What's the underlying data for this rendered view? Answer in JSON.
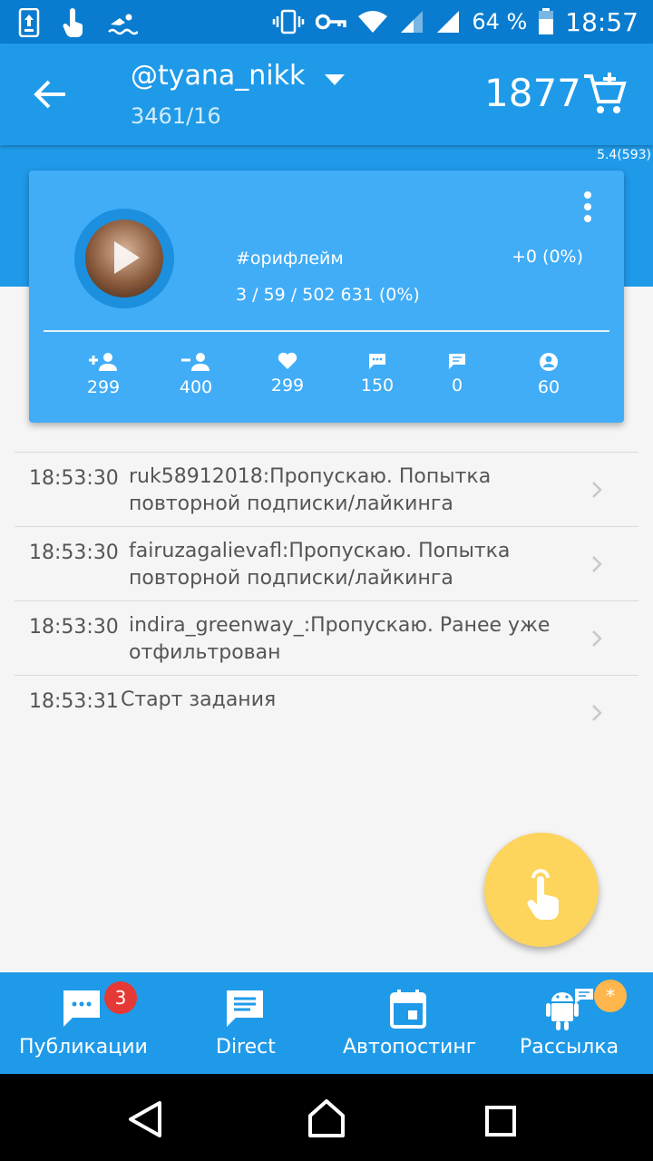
{
  "status_bar": {
    "battery_percent": "64 %",
    "time": "18:57"
  },
  "app_bar": {
    "account": "@tyana_nikk",
    "account_stats": "3461/16",
    "balance": "1877"
  },
  "version": "5.4(593)",
  "card": {
    "hashtag": "#орифлейм",
    "delta": "+0 (0%)",
    "counts": "3 / 59 / 502 631 (0%)",
    "stats": [
      {
        "icon": "follow-icon",
        "value": "299"
      },
      {
        "icon": "unfollow-icon",
        "value": "400"
      },
      {
        "icon": "heart-icon",
        "value": "299"
      },
      {
        "icon": "comment-icon",
        "value": "150"
      },
      {
        "icon": "message-icon",
        "value": "0"
      },
      {
        "icon": "profile-icon",
        "value": "60"
      }
    ]
  },
  "log": [
    {
      "time": "18:53:30",
      "message": "ruk58912018:Пропускаю. Попытка повторной подписки/лайкинга"
    },
    {
      "time": "18:53:30",
      "message": "fairuzagalievafl:Пропускаю. Попытка повторной подписки/лайкинга"
    },
    {
      "time": "18:53:30",
      "message": "indira_greenway_:Пропускаю. Ранее уже отфильтрован"
    },
    {
      "time": "18:53:31",
      "message": "Старт задания"
    }
  ],
  "bottom_nav": [
    {
      "label": "Публикации",
      "badge": "3",
      "icon": "publications-icon"
    },
    {
      "label": "Direct",
      "icon": "direct-icon"
    },
    {
      "label": "Автопостинг",
      "icon": "calendar-icon"
    },
    {
      "label": "Рассылка",
      "badge": "*",
      "icon": "android-icon"
    }
  ],
  "colors": {
    "primary": "#1f9ae9",
    "status_bar": "#0a7ccf",
    "card": "#41adf7",
    "fab": "#fdd45c",
    "badge_red": "#e53935",
    "badge_orange": "#ffb74d"
  }
}
